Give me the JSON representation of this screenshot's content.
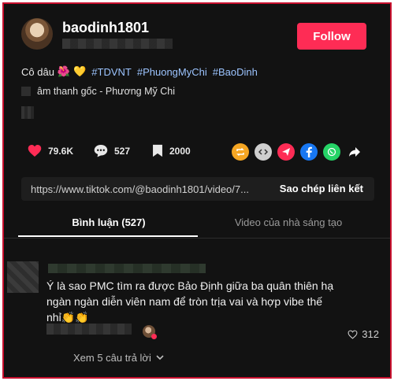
{
  "header": {
    "username": "baodinh1801",
    "follow_label": "Follow"
  },
  "caption": {
    "text": "Cô dâu",
    "flower_emoji": "🌺",
    "heart_emoji": "💛",
    "hashtags": [
      "#TDVNT",
      "#PhuongMyChi",
      "#BaoDinh"
    ]
  },
  "music": {
    "label": "âm thanh gốc - Phương Mỹ Chi"
  },
  "actions": {
    "likes": "79.6K",
    "comments": "527",
    "saves": "2000"
  },
  "share_icons": [
    {
      "name": "repost-icon",
      "color": "#f5a623"
    },
    {
      "name": "embed-icon",
      "color": "#cfcfcf"
    },
    {
      "name": "send-icon",
      "color": "#fe2c55"
    },
    {
      "name": "facebook-icon",
      "color": "#1877f2"
    },
    {
      "name": "whatsapp-icon",
      "color": "#25d366"
    },
    {
      "name": "share-arrow-icon",
      "color": "#ffffff"
    }
  ],
  "link": {
    "url": "https://www.tiktok.com/@baodinh1801/video/7...",
    "copy_label": "Sao chép liên kết"
  },
  "tabs": [
    {
      "label": "Bình luận (527)",
      "active": true
    },
    {
      "label": "Video của nhà sáng tạo",
      "active": false
    }
  ],
  "comment": {
    "text_line1": "Ý là sao PMC tìm ra được Bảo Định giữa ba quân thiên hạ",
    "text_line2": "ngàn ngàn diễn viên nam để tròn trịa vai và hợp vibe thế",
    "text_line3": "nhỉ👏👏",
    "like_count": "312",
    "replies_label": "Xem 5 câu trả lời"
  }
}
